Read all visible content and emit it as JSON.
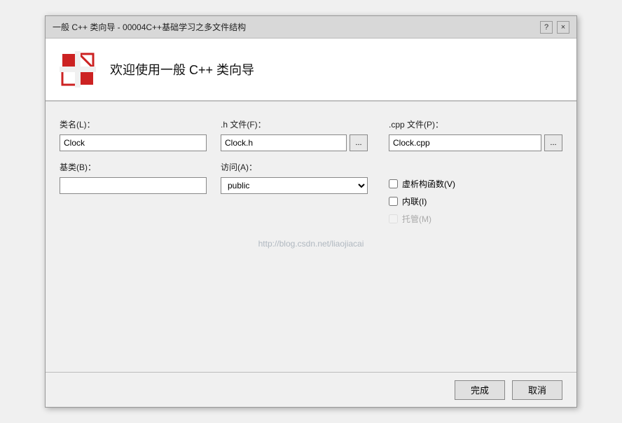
{
  "titleBar": {
    "text": "一般 C++ 类向导 - 00004C++基础学习之多文件结构",
    "helpBtn": "?",
    "closeBtn": "×"
  },
  "header": {
    "title": "欢迎使用一般 C++ 类向导"
  },
  "form": {
    "classNameLabel": "类名(L)：",
    "classNameValue": "Clock",
    "hFileLabel": ".h 文件(F)：",
    "hFileValue": "Clock.h",
    "cppFileLabel": ".cpp 文件(P)：",
    "cppFileValue": "Clock.cpp",
    "baseClassLabel": "基类(B)：",
    "baseClassValue": "",
    "accessLabel": "访问(A)：",
    "accessValue": "public",
    "browseLabel": "...",
    "virtualDestructorLabel": "虚析构函数(V)",
    "inlineLabel": "内联(I)",
    "managedLabel": "托管(M)"
  },
  "watermark": {
    "text": "http://blog.csdn.net/liaojiacai"
  },
  "footer": {
    "finishBtn": "完成",
    "cancelBtn": "取消"
  }
}
